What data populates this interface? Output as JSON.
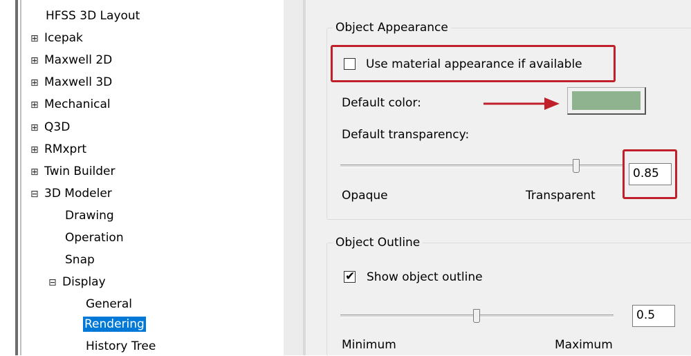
{
  "tree": {
    "items": [
      {
        "label": "HFSS 3D Layout",
        "expander": ""
      },
      {
        "label": "Icepak",
        "expander": "⊞"
      },
      {
        "label": "Maxwell 2D",
        "expander": "⊞"
      },
      {
        "label": "Maxwell 3D",
        "expander": "⊞"
      },
      {
        "label": "Mechanical",
        "expander": "⊞"
      },
      {
        "label": "Q3D",
        "expander": "⊞"
      },
      {
        "label": "RMxprt",
        "expander": "⊞"
      },
      {
        "label": "Twin Builder",
        "expander": "⊞"
      },
      {
        "label": "3D Modeler",
        "expander": "⊟"
      },
      {
        "label": "Drawing",
        "expander": ""
      },
      {
        "label": "Operation",
        "expander": ""
      },
      {
        "label": "Snap",
        "expander": ""
      },
      {
        "label": "Display",
        "expander": "⊟"
      },
      {
        "label": "General",
        "expander": ""
      },
      {
        "label": "Rendering",
        "expander": "",
        "selected": true
      },
      {
        "label": "History Tree",
        "expander": ""
      }
    ]
  },
  "appearance": {
    "group_title": "Object Appearance",
    "use_material_label": "Use material appearance if available",
    "use_material_checked": false,
    "default_color_label": "Default color:",
    "default_color": "#8fb38f",
    "transparency_label": "Default transparency:",
    "transparency_value": "0.85",
    "transparency_level": 0.85,
    "min_label": "Opaque",
    "max_label": "Transparent"
  },
  "outline": {
    "group_title": "Object Outline",
    "show_outline_label": "Show object outline",
    "show_outline_checked": true,
    "outline_value": "0.5",
    "outline_level": 0.5,
    "min_label": "Minimum",
    "max_label": "Maximum"
  },
  "colors": {
    "highlight": "#c0202a",
    "selection": "#0078d7"
  }
}
